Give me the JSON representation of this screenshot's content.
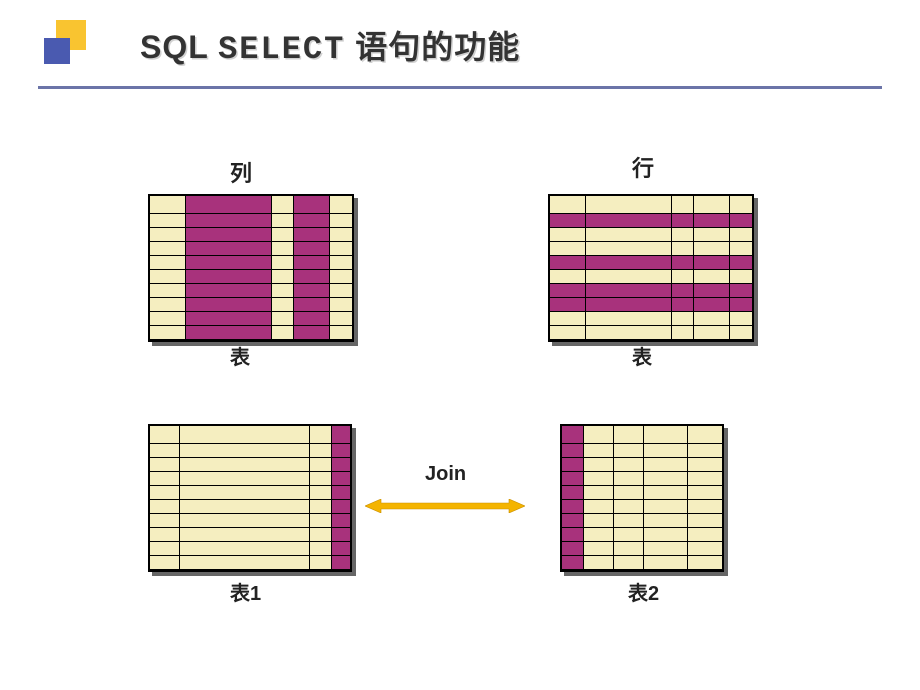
{
  "title": {
    "pre": "SQL ",
    "keyword": "SELECT",
    "post": " 语句的功能"
  },
  "labels": {
    "columns": "列",
    "rows": "行",
    "table_generic_left": "表",
    "table_generic_right": "表",
    "table1": "表1",
    "table2": "表2",
    "join": "Join"
  },
  "chart_data": {
    "type": "diagram",
    "description": "Illustration of SQL SELECT capabilities: column projection, row selection, and table join.",
    "tables": {
      "top_left": {
        "caption_above": "列",
        "caption_below": "表",
        "rows": 10,
        "columns": 5,
        "highlight": "columns",
        "highlighted_col_indices_zero_based": [
          1,
          3
        ]
      },
      "top_right": {
        "caption_above": "行",
        "caption_below": "表",
        "rows": 10,
        "columns": 5,
        "highlight": "rows",
        "highlighted_row_indices_zero_based": [
          1,
          4,
          6,
          7
        ]
      },
      "bottom_left": {
        "caption_below": "表1",
        "rows": 10,
        "columns": 4,
        "highlight": "columns",
        "highlighted_col_indices_zero_based": [
          3
        ]
      },
      "bottom_right": {
        "caption_below": "表2",
        "rows": 10,
        "columns": 5,
        "highlight": "columns",
        "highlighted_col_indices_zero_based": [
          0
        ]
      }
    },
    "connector": {
      "label": "Join",
      "between": [
        "bottom_left",
        "bottom_right"
      ],
      "style": "double-headed-arrow",
      "color": "#f4b400"
    }
  }
}
